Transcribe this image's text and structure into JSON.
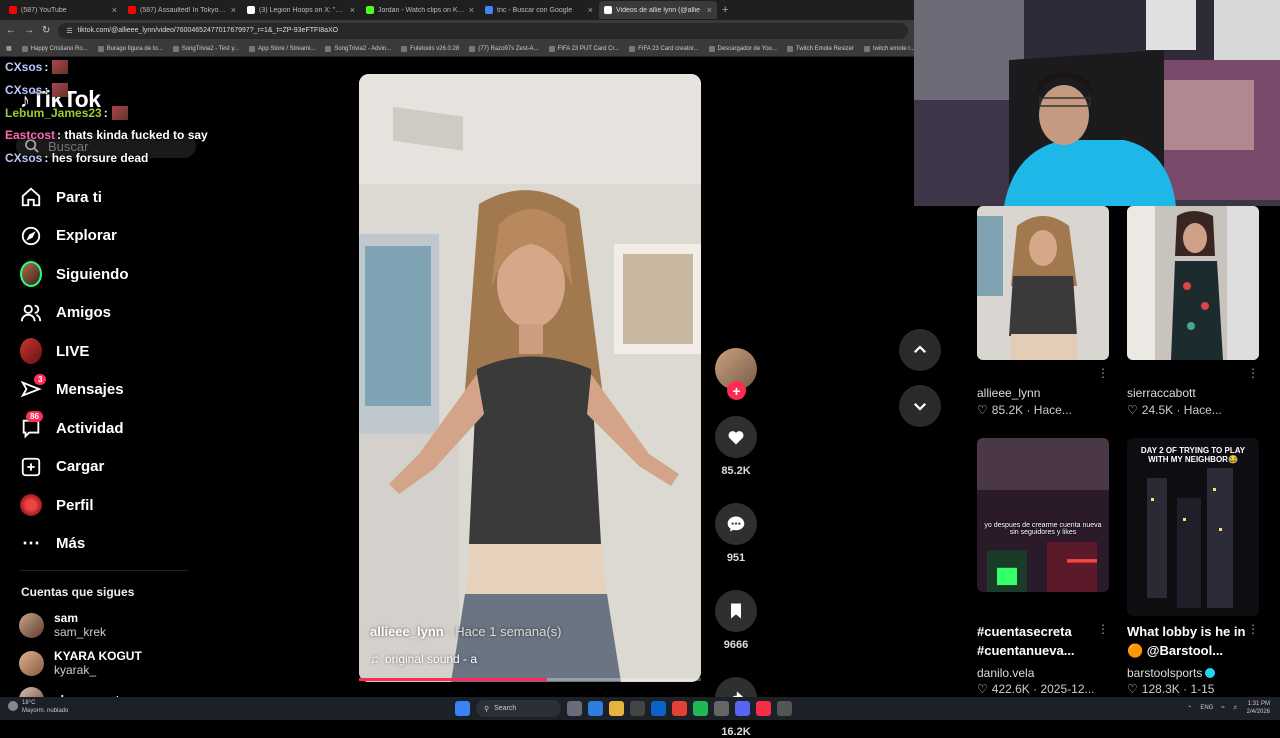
{
  "browser": {
    "tabs": [
      {
        "title": "(587) YouTube",
        "color": "#ff0000"
      },
      {
        "title": "(587) Assaulted! In Tokyo Pt.o",
        "color": "#ff0000"
      },
      {
        "title": "(3) Legion Hoops on X: \"FULL T",
        "color": "#ffffff"
      },
      {
        "title": "Jordan - Watch clips on Kick",
        "color": "#53fc18"
      },
      {
        "title": "tnc - Buscar con Google",
        "color": "#4285f4"
      },
      {
        "title": "Videos de allie lynn (@allie",
        "color": "#ffffff",
        "active": true
      }
    ],
    "url": "tiktok.com/@allieee_lynn/video/7600465247701767997?_r=1&_t=ZP-93eFTFI8aXO",
    "bookmarks": [
      "Happy Cristiano Ro...",
      "Burago figura de to...",
      "SongTrivia2 - Test y...",
      "App Store / Streami...",
      "SongTrivia2 - Advin...",
      "Fuletools v26.0.28",
      "(77) Razo97s Zest-A...",
      "FIFA 23 PUT Card Cr...",
      "FIFA 23 Card creator...",
      "Descargador de Yoo...",
      "Twitch Emote Resizer",
      "twitch emote r..."
    ]
  },
  "tiktok": {
    "logo": "TikTok",
    "search_placeholder": "Buscar",
    "nav": [
      {
        "label": "Para ti"
      },
      {
        "label": "Explorar"
      },
      {
        "label": "Siguiendo"
      },
      {
        "label": "Amigos"
      },
      {
        "label": "LIVE"
      },
      {
        "label": "Mensajes",
        "badge": "3"
      },
      {
        "label": "Actividad",
        "badge": "86"
      },
      {
        "label": "Cargar"
      },
      {
        "label": "Perfil"
      },
      {
        "label": "Más"
      }
    ],
    "following_title": "Cuentas que sigues",
    "following": [
      {
        "name": "sam",
        "handle": "sam_krek"
      },
      {
        "name": "KYARA KOGUT",
        "handle": "kyarak_"
      },
      {
        "name": "alessaamot",
        "handle": ""
      }
    ]
  },
  "chat": [
    {
      "user": "CXsos",
      "text": " :",
      "color": "#b9c7ff"
    },
    {
      "user": "CXsos",
      "text": " :",
      "color": "#b9c7ff"
    },
    {
      "user": "Lebum_James23",
      "text": " :",
      "color": "#9acd32"
    },
    {
      "user": "Eastcost",
      "text": " : thats kinda fucked to say",
      "color": "#ff69b4"
    },
    {
      "user": "CXsos",
      "text": " : hes forsure dead",
      "color": "#b9c7ff"
    }
  ],
  "video": {
    "username": "allieee_lynn",
    "time": " · Hace 1 semana(s)",
    "sound": "original sound - a",
    "progress": 0.55,
    "likes": "85.2K",
    "comments": "951",
    "saves": "9666",
    "shares": "16.2K"
  },
  "grid": [
    {
      "user": "allieee_lynn",
      "stats": "85.2K · Hace..."
    },
    {
      "user": "sierraccabott",
      "stats": "24.5K · Hace..."
    },
    {
      "title": "#cuentasecreta #cuentanueva...",
      "user": "danilo.vela",
      "stats": "422.6K · 2025-12...",
      "overlay": "yo despues de crearme cuenta nueva sin seguidores y likes"
    },
    {
      "title": "What lobby is he in 🟠 @Barstool...",
      "user": "barstoolsports",
      "stats": "128.3K · 1-15",
      "overlay": "DAY 2 OF TRYING TO PLAY WITH MY NEIGHBOR😂"
    }
  ],
  "taskbar": {
    "weather_temp": "18°C",
    "weather_text": "Mayorm. nublado",
    "search": "Search",
    "lang": "ENG",
    "time": "1:31 PM",
    "date": "2/4/2026"
  }
}
